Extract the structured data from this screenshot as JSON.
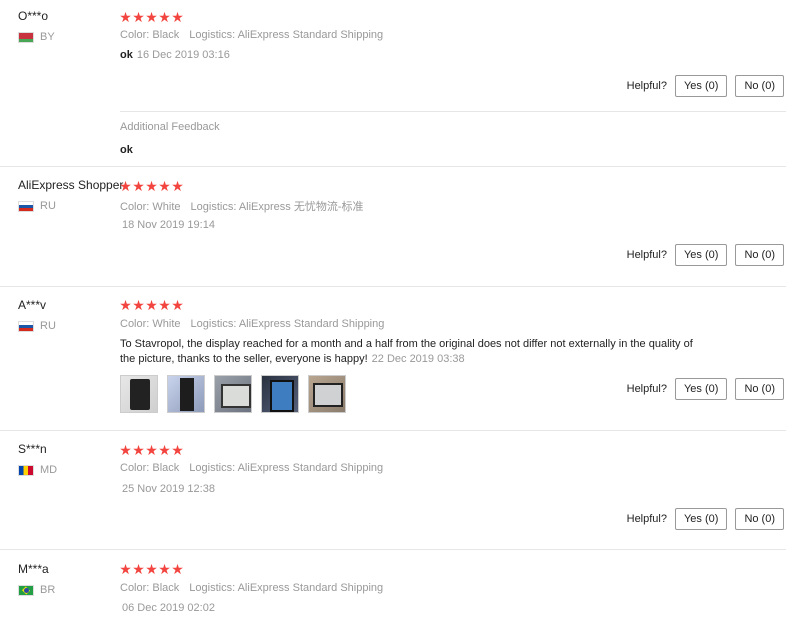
{
  "helpful_label": "Helpful?",
  "additional_feedback_label": "Additional Feedback",
  "star_glyph": "★",
  "reviews": [
    {
      "user": "O***o",
      "country": "BY",
      "color": "Color: Black",
      "logistics": "Logistics: AliExpress Standard Shipping",
      "text": "ok",
      "date": "16 Dec 2019 03:16",
      "yes": "Yes (0)",
      "no": "No (0)",
      "additional_text": "ok"
    },
    {
      "user": "AliExpress Shopper",
      "country": "RU",
      "color": "Color: White",
      "logistics": "Logistics: AliExpress 无忧物流-标准",
      "date": "18 Nov 2019 19:14",
      "yes": "Yes (0)",
      "no": "No (0)"
    },
    {
      "user": "A***v",
      "country": "RU",
      "color": "Color: White",
      "logistics": "Logistics: AliExpress Standard Shipping",
      "text_line1": "To Stavropol, the display reached for a month and a half from the original does not differ not externally in the quality of",
      "text_line2": "the picture, thanks to the seller, everyone is happy!",
      "date": "22 Dec 2019 03:38",
      "yes": "Yes (0)",
      "no": "No (0)"
    },
    {
      "user": "S***n",
      "country": "MD",
      "color": "Color: Black",
      "logistics": "Logistics: AliExpress Standard Shipping",
      "date": "25 Nov 2019 12:38",
      "yes": "Yes (0)",
      "no": "No (0)"
    },
    {
      "user": "M***a",
      "country": "BR",
      "color": "Color: Black",
      "logistics": "Logistics: AliExpress Standard Shipping",
      "date": "06 Dec 2019 02:02"
    }
  ],
  "rating_color": "#f3453f"
}
